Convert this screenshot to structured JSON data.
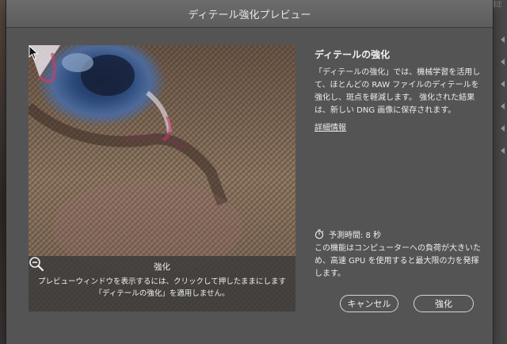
{
  "window": {
    "title": "ディテール強化プレビュー"
  },
  "background": {
    "corner_label": "自動補正"
  },
  "preview": {
    "caption_title": "強化",
    "caption_line1": "プレビューウィンドウを表示するには、クリックして押したままにします",
    "caption_line2": "「ディテールの強化」を適用しません。",
    "zoom_icon": "zoom-out-icon",
    "cursor_icon": "pointer-cursor-icon"
  },
  "panel": {
    "heading": "ディテールの強化",
    "description_lines": [
      "「ディテールの強化」では、機械学習を活用し",
      "て、ほとんどの RAW ファイルのディテールを",
      "強化し、斑点を軽減します。 強化された結果",
      "は、新しい DNG 画像に保存されます。"
    ],
    "learn_more": "詳細情報",
    "timer_icon": "stopwatch-icon",
    "estimate": "予測時間: 8 秒",
    "performance_lines": [
      "この機能はコンピューターへの負荷が大きいた",
      "め、高速 GPU を使用すると最大限の力を発揮",
      "します。"
    ]
  },
  "buttons": {
    "cancel": "キャンセル",
    "enhance": "強化"
  },
  "colors": {
    "sheet": "#545454",
    "titlebar": "#636363",
    "text": "#ececec",
    "button_border": "#d6d6d6"
  }
}
